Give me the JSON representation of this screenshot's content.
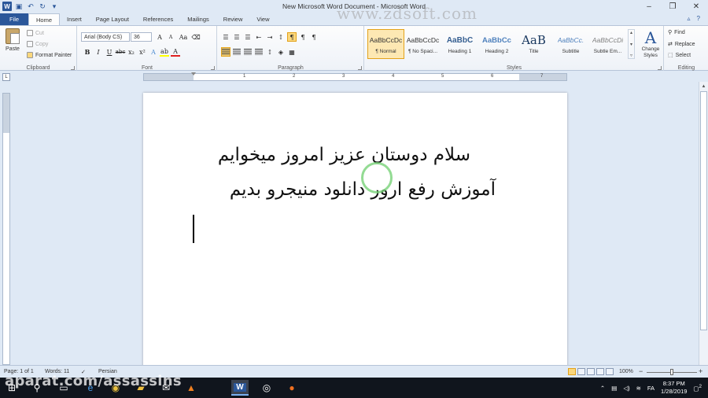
{
  "window": {
    "title": "New Microsoft Word Document  -  Microsoft Word",
    "watermark": "www.zdsoft.com",
    "controls": [
      "–",
      "❐",
      "✕"
    ]
  },
  "tabs": [
    "File",
    "Home",
    "Insert",
    "Page Layout",
    "References",
    "Mailings",
    "Review",
    "View"
  ],
  "active_tab": "Home",
  "ribbon": {
    "clipboard": {
      "label": "Clipboard",
      "paste": "Paste",
      "cut": "Cut",
      "copy": "Copy",
      "format_painter": "Format Painter"
    },
    "font": {
      "label": "Font",
      "font_name": "Arial (Body CS)",
      "font_size": "36"
    },
    "paragraph": {
      "label": "Paragraph"
    },
    "styles": {
      "label": "Styles",
      "items": [
        {
          "sample": "AaBbCcDc",
          "name": "¶ Normal"
        },
        {
          "sample": "AaBbCcDc",
          "name": "¶ No Spaci..."
        },
        {
          "sample": "AaBbC",
          "name": "Heading 1"
        },
        {
          "sample": "AaBbCc",
          "name": "Heading 2"
        },
        {
          "sample": "AaB",
          "name": "Title"
        },
        {
          "sample": "AaBbCc.",
          "name": "Subtitle"
        },
        {
          "sample": "AaBbCcDi",
          "name": "Subtle Em..."
        }
      ],
      "selected_index": 0,
      "change_styles": "Change Styles"
    },
    "editing": {
      "label": "Editing",
      "find": "Find",
      "replace": "Replace",
      "select": "Select"
    }
  },
  "ruler_numbers": [
    "1",
    "2",
    "3",
    "4",
    "5",
    "6",
    "7"
  ],
  "document": {
    "lines": [
      "سلام دوستان عزیز امروز میخوایم",
      "آموزش رفع ارور دانلود منیجرو بدیم"
    ]
  },
  "status": {
    "page": "Page: 1 of 1",
    "words": "Words: 11",
    "language": "Persian",
    "zoom": "100%"
  },
  "taskbar": {
    "watermark": "aparat.com/assassins",
    "lang": "FA",
    "time": "8:37 PM",
    "date": "1/28/2019",
    "notifications": "2"
  }
}
